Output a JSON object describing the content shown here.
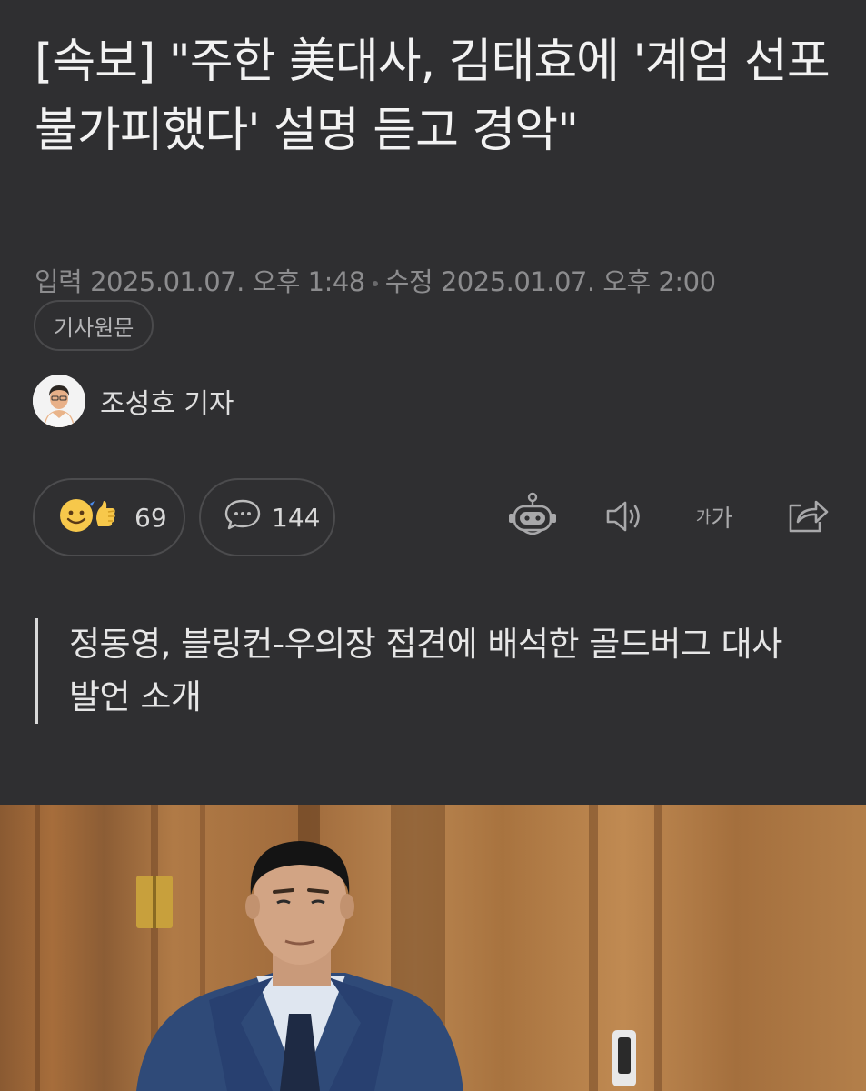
{
  "article": {
    "headline": "[속보] \"주한 美대사, 김태효에 '계엄 선포 불가피했다' 설명 듣고 경악\"",
    "published": "입력 2025.01.07. 오후 1:48",
    "modified": "수정 2025.01.07. 오후 2:00",
    "original_label": "기사원문",
    "author": "조성호 기자",
    "subheading": "정동영, 블링컨-우의장 접견에 배석한 골드버그 대사 발언 소개"
  },
  "reactions": {
    "like_count": "69",
    "comment_count": "144"
  },
  "toolbar": {
    "fontsize_small": "가",
    "fontsize_large": "가"
  },
  "icons": [
    "emoji-like-icon",
    "comment-icon",
    "robot-summary-icon",
    "speaker-icon",
    "font-size-icon",
    "share-icon"
  ],
  "colors": {
    "background": "#2f2f31",
    "meta_text": "#8c8c8e",
    "border": "#4c4c4e"
  }
}
